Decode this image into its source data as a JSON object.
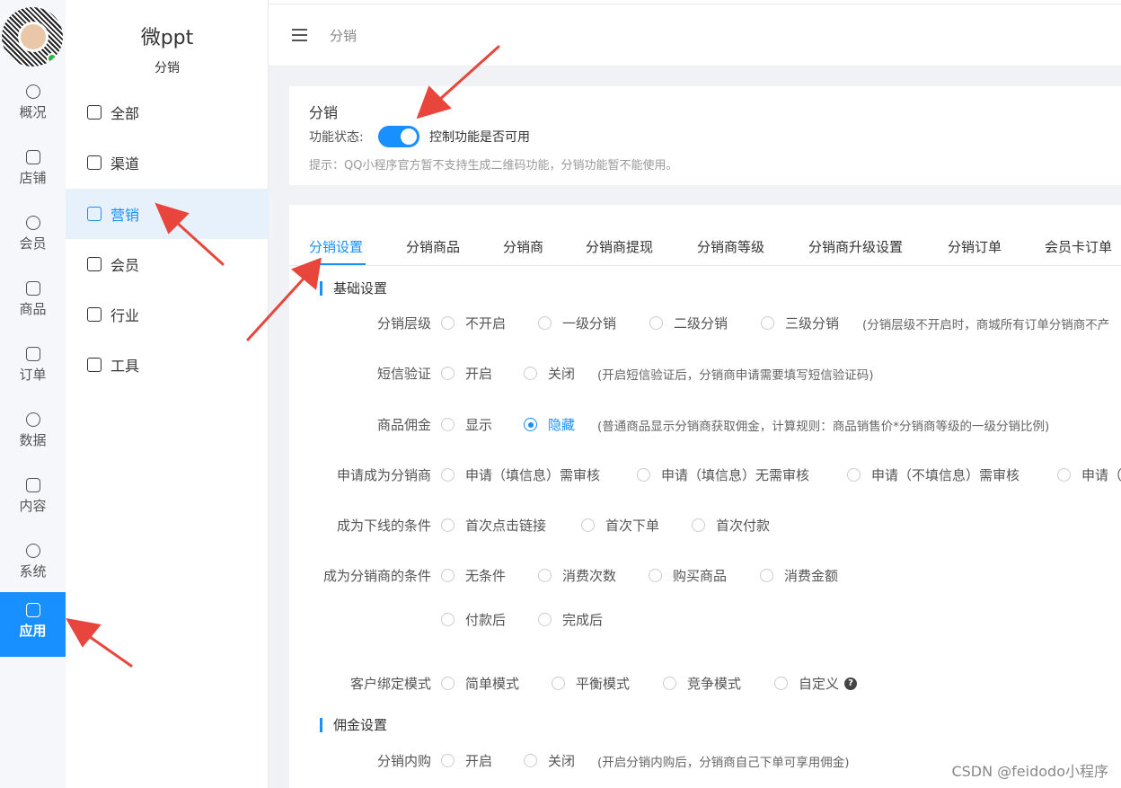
{
  "app": {
    "brand": "微ppt",
    "brand_sub": "分销"
  },
  "rail": {
    "items": [
      {
        "label": "概况"
      },
      {
        "label": "店铺"
      },
      {
        "label": "会员"
      },
      {
        "label": "商品"
      },
      {
        "label": "订单"
      },
      {
        "label": "数据"
      },
      {
        "label": "内容"
      },
      {
        "label": "系统"
      },
      {
        "label": "应用",
        "active": true
      }
    ]
  },
  "sidebar": {
    "items": [
      {
        "label": "全部"
      },
      {
        "label": "渠道"
      },
      {
        "label": "营销",
        "active": true
      },
      {
        "label": "会员"
      },
      {
        "label": "行业"
      },
      {
        "label": "工具"
      }
    ]
  },
  "header": {
    "breadcrumb": "分销"
  },
  "status_card": {
    "title": "分销",
    "label": "功能状态:",
    "switch_on": true,
    "description": "控制功能是否可用",
    "tip": "提示：QQ小程序官方暂不支持生成二维码功能，分销功能暂不能使用。"
  },
  "tabs": [
    {
      "label": "分销设置",
      "active": true
    },
    {
      "label": "分销商品"
    },
    {
      "label": "分销商"
    },
    {
      "label": "分销商提现"
    },
    {
      "label": "分销商等级"
    },
    {
      "label": "分销商升级设置"
    },
    {
      "label": "分销订单"
    },
    {
      "label": "会员卡订单"
    }
  ],
  "sections": {
    "basic": "基础设置",
    "commission": "佣金设置"
  },
  "form": {
    "level": {
      "label": "分销层级",
      "options": [
        "不开启",
        "一级分销",
        "二级分销",
        "三级分销"
      ],
      "hint": "(分销层级不开启时，商城所有订单分销商不产"
    },
    "sms": {
      "label": "短信验证",
      "options": [
        "开启",
        "关闭"
      ],
      "hint": "(开启短信验证后，分销商申请需要填写短信验证码)"
    },
    "commission_show": {
      "label": "商品佣金",
      "options": [
        "显示",
        "隐藏"
      ],
      "selected": "隐藏",
      "hint": "(普通商品显示分销商获取佣金，计算规则：商品销售价*分销商等级的一级分销比例)"
    },
    "apply": {
      "label": "申请成为分销商",
      "options": [
        "申请（填信息）需审核",
        "申请（填信息）无需审核",
        "申请（不填信息）需审核",
        "申请（"
      ]
    },
    "downline": {
      "label": "成为下线的条件",
      "options": [
        "首次点击链接",
        "首次下单",
        "首次付款"
      ]
    },
    "become": {
      "label": "成为分销商的条件",
      "options": [
        "无条件",
        "消费次数",
        "购买商品",
        "消费金额"
      ],
      "options2": [
        "付款后",
        "完成后"
      ]
    },
    "binding": {
      "label": "客户绑定模式",
      "options": [
        "简单模式",
        "平衡模式",
        "竞争模式",
        "自定义"
      ]
    },
    "self_buy": {
      "label": "分销内购",
      "options": [
        "开启",
        "关闭"
      ],
      "hint": "(开启分销内购后，分销商自己下单可享用佣金)"
    }
  },
  "watermark": "CSDN @feidodo小程序",
  "colors": {
    "accent": "#1890ff",
    "arrow": "#e8453c"
  }
}
